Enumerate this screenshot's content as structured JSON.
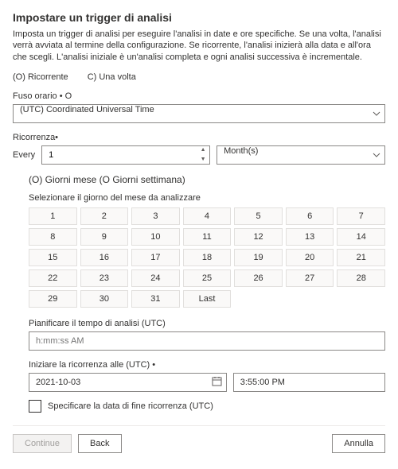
{
  "title": "Impostare un trigger di analisi",
  "description": "Imposta un trigger di analisi per eseguire l'analisi in date e ore specifiche. Se una volta, l'analisi verrà avviata al termine della configurazione. Se ricorrente, l'analisi inizierà alla data e all'ora che scegli. L'analisi iniziale è un'analisi completa e ogni analisi successiva è incrementale.",
  "trigger": {
    "recurring_label": "(O) Ricorrente",
    "once_label": "C) Una volta"
  },
  "timezone": {
    "label": "Fuso orario • O",
    "value": "(UTC) Coordinated Universal Time"
  },
  "recurrence": {
    "label": "Ricorrenza•",
    "every_label": "Every",
    "interval_value": "1",
    "unit_value": "Month(s)"
  },
  "day_mode": {
    "label": "(O) Giorni mese (O Giorni settimana)"
  },
  "month_days": {
    "label": "Selezionare il giorno del mese da analizzare",
    "cells": [
      "1",
      "2",
      "3",
      "4",
      "5",
      "6",
      "7",
      "8",
      "9",
      "10",
      "11",
      "12",
      "13",
      "14",
      "15",
      "16",
      "17",
      "18",
      "19",
      "20",
      "21",
      "22",
      "23",
      "24",
      "25",
      "26",
      "27",
      "28",
      "29",
      "30",
      "31",
      "Last"
    ]
  },
  "schedule_time": {
    "label": "Pianificare il tempo di analisi (UTC)",
    "placeholder": "h:mm:ss AM"
  },
  "start_recurrence": {
    "label": "Iniziare la ricorrenza alle (UTC) •",
    "date_value": "2021-10-03",
    "time_value": "3:55:00 PM"
  },
  "end_date_checkbox": {
    "label": "Specificare la data di fine ricorrenza (UTC)"
  },
  "footer": {
    "continue_label": "Continue",
    "back_label": "Back",
    "cancel_label": "Annulla"
  }
}
